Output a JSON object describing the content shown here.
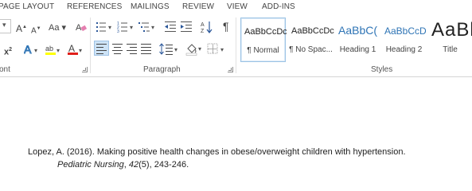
{
  "tabs": [
    "PAGE LAYOUT",
    "REFERENCES",
    "MAILINGS",
    "REVIEW",
    "VIEW",
    "ADD-INS"
  ],
  "font_group": {
    "label": "ont",
    "font_size_value": "",
    "grow_font": "A",
    "shrink_font": "A",
    "change_case": "Aa",
    "subscript": "x",
    "superscript_mark": "2"
  },
  "paragraph_group": {
    "label": "Paragraph",
    "sort": "A↓Z",
    "show_marks": "¶"
  },
  "styles_group": {
    "label": "Styles",
    "items": [
      {
        "sample": "AaBbCcDc",
        "name": "¶ Normal"
      },
      {
        "sample": "AaBbCcDc",
        "name": "¶ No Spac..."
      },
      {
        "sample": "AaBbC(",
        "name": "Heading 1"
      },
      {
        "sample": "AaBbCcD",
        "name": "Heading 2"
      },
      {
        "sample": "AaBl",
        "name": "Title"
      }
    ]
  },
  "colors": {
    "accent": "#2b579a",
    "heading_blue": "#2e74b5",
    "font_color_red": "#e0201b",
    "highlight_yellow": "#ffff00",
    "selected_bg": "#cde3f6"
  },
  "document": {
    "line1": "Lopez, A. (2016). Making positive health changes in obese/overweight children with hypertension.",
    "journal": "Pediatric Nursing",
    "sep1": ", ",
    "volume": "42",
    "issue_pages": "(5), 243-246."
  }
}
